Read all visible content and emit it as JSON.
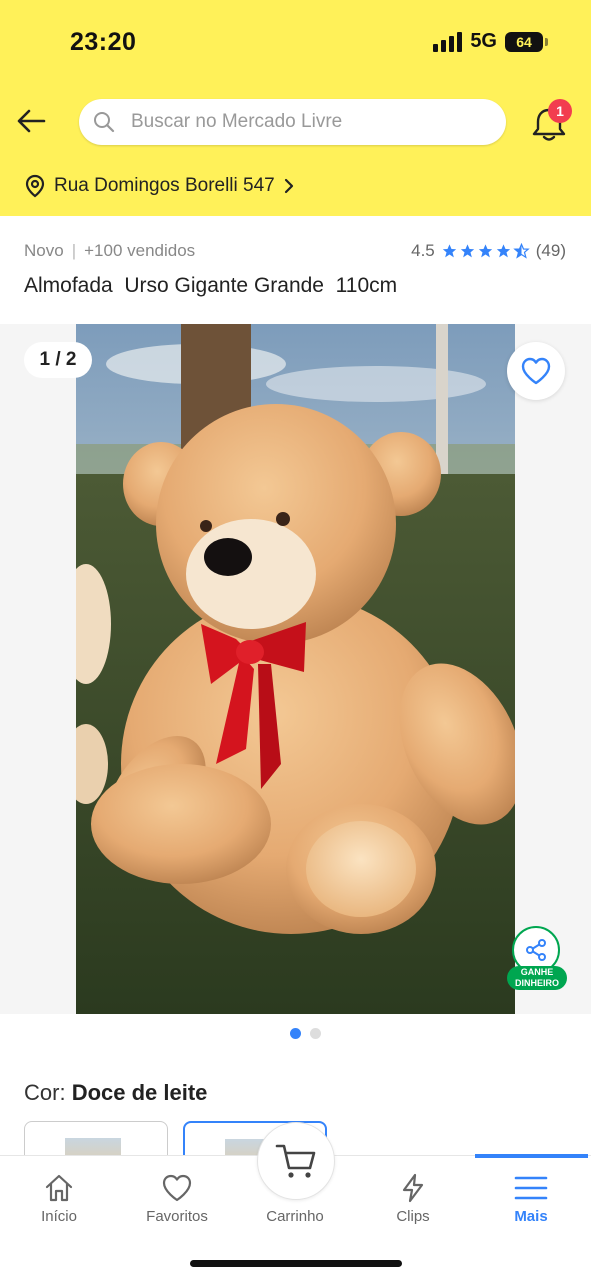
{
  "status_bar": {
    "time": "23:20",
    "network": "5G",
    "battery": "64"
  },
  "header": {
    "search_placeholder": "Buscar no Mercado Livre",
    "notifications_count": "1",
    "address": "Rua Domingos Borelli 547",
    "accent": "#fff159"
  },
  "product": {
    "condition": "Novo",
    "sold": "+100 vendidos",
    "rating": "4.5",
    "rating_value": 4.5,
    "review_count": "(49)",
    "title": "Almofada  Urso Gigante Grande  110cm",
    "gallery_counter": "1 / 2",
    "gallery_total": 2,
    "gallery_current": 1,
    "share_label_line1": "GANHE",
    "share_label_line2": "DINHEIRO",
    "color_label": "Cor:",
    "color_value": "Doce de leite"
  },
  "tabbar": {
    "items": [
      {
        "label": "Início",
        "icon": "home-icon"
      },
      {
        "label": "Favoritos",
        "icon": "heart-icon"
      },
      {
        "label": "Carrinho",
        "icon": "cart-icon"
      },
      {
        "label": "Clips",
        "icon": "bolt-icon"
      },
      {
        "label": "Mais",
        "icon": "menu-icon"
      }
    ],
    "active": "Mais",
    "accent": "#3483fa"
  }
}
